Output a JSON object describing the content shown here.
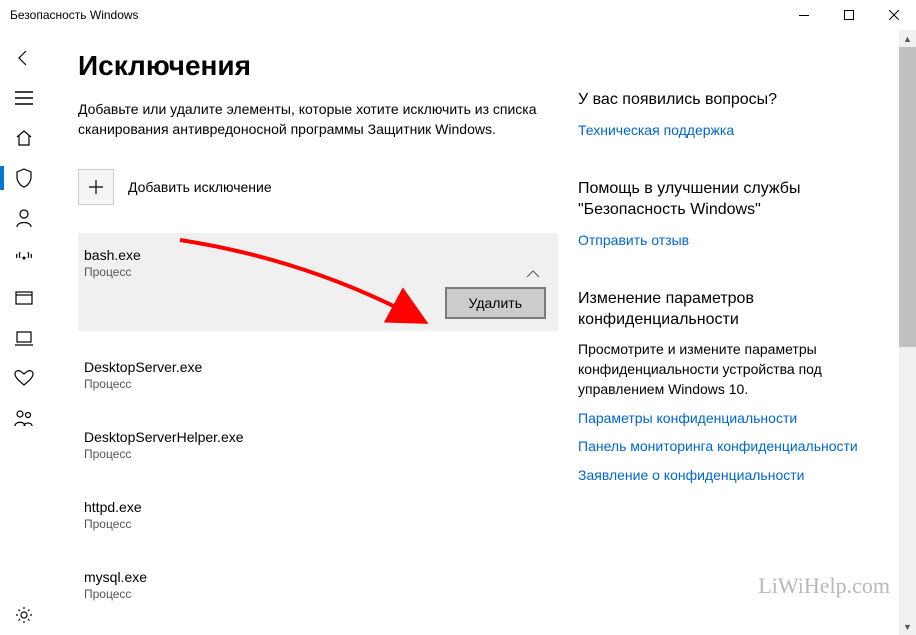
{
  "window": {
    "title": "Безопасность Windows"
  },
  "page": {
    "title": "Исключения",
    "description": "Добавьте или удалите элементы, которые хотите исключить из списка сканирования антивредоносной программы Защитник Windows.",
    "add_label": "Добавить исключение"
  },
  "exclusions": [
    {
      "name": "bash.exe",
      "type": "Процесс",
      "expanded": true,
      "delete_label": "Удалить"
    },
    {
      "name": "DesktopServer.exe",
      "type": "Процесс",
      "expanded": false
    },
    {
      "name": "DesktopServerHelper.exe",
      "type": "Процесс",
      "expanded": false
    },
    {
      "name": "httpd.exe",
      "type": "Процесс",
      "expanded": false
    },
    {
      "name": "mysql.exe",
      "type": "Процесс",
      "expanded": false
    }
  ],
  "side": {
    "questions": {
      "heading": "У вас появились вопросы?",
      "link": "Техническая поддержка"
    },
    "help": {
      "heading": "Помощь в улучшении службы \"Безопасность Windows\"",
      "link": "Отправить отзыв"
    },
    "privacy": {
      "heading": "Изменение параметров конфиденциальности",
      "text": "Просмотрите и измените параметры конфиденциальности устройства под управлением Windows 10.",
      "links": [
        "Параметры конфиденциальности",
        "Панель мониторинга конфиденциальности",
        "Заявление о конфиденциальности"
      ]
    }
  },
  "watermark": "LiWiHelp.com"
}
